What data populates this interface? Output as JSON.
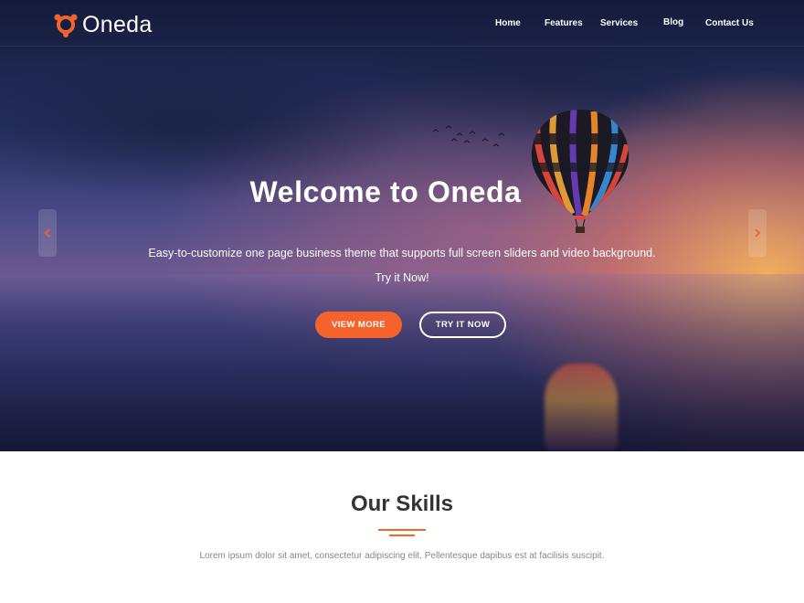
{
  "brand": {
    "name": "Oneda",
    "accent": "#f3632b"
  },
  "nav": {
    "items": [
      {
        "label": "Home"
      },
      {
        "label": "Features"
      },
      {
        "label": "Services"
      },
      {
        "label": "Blog"
      },
      {
        "label": "Contact Us"
      }
    ]
  },
  "hero": {
    "title": "Welcome to Oneda",
    "subtitle": "Easy-to-customize one page business theme that supports full screen sliders and video background.",
    "subtitle2": "Try it Now!",
    "primary_button": "VIEW MORE",
    "secondary_button": "TRY IT NOW",
    "prev_icon": "chevron-left-icon",
    "next_icon": "chevron-right-icon"
  },
  "skills": {
    "title": "Our Skills",
    "description": "Lorem ipsum dolor sit amet, consectetur adipiscing elit. Pellentesque dapibus est at facilisis suscipit."
  }
}
